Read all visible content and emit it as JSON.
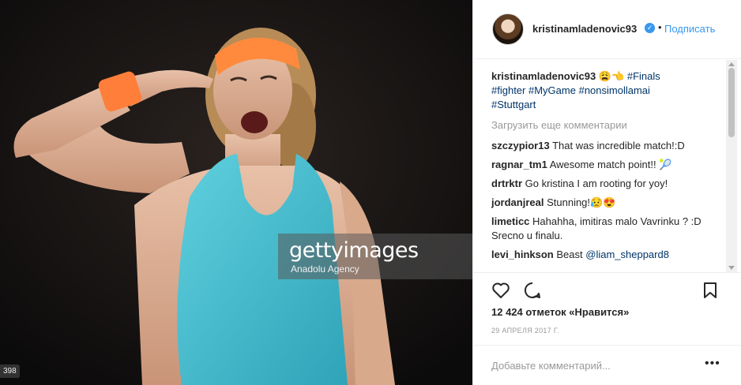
{
  "photo": {
    "watermark_logo": "gettyimages",
    "watermark_agency": "Anadolu Agency",
    "corner_id": "398"
  },
  "post": {
    "username": "kristinamladenovic93",
    "verified_icon": "verified-badge-icon",
    "separator": "•",
    "follow_label": "Подписать",
    "caption": {
      "username": "kristinamladenovic93",
      "emojis": "😩👈",
      "tags": [
        "#Finals",
        "#fighter",
        "#MyGame",
        "#nonsimollamai",
        "#Stuttgart"
      ]
    },
    "load_more": "Загрузить еще комментарии",
    "comments": [
      {
        "user": "szczypior13",
        "text": "That was incredible match!:D"
      },
      {
        "user": "ragnar_tm1",
        "text": "Awesome match point!! 🎾"
      },
      {
        "user": "drtrktr",
        "text": "Go kristina I am rooting for yoy!"
      },
      {
        "user": "jordanjreal",
        "text": "Stunning!😥😍"
      },
      {
        "user": "limeticc",
        "text": "Hahahha, imitiras malo Vavrinku ? :D Srecno u finalu."
      },
      {
        "user": "levi_hinkson",
        "text": "Beast",
        "mention": "@liam_sheppard8"
      }
    ],
    "likes": "12 424 отметок «Нравится»",
    "date": "29 АПРЕЛЯ 2017 Г.",
    "comment_placeholder": "Добавьте комментарий...",
    "more_icon": "more-dots-icon"
  },
  "colors": {
    "accent": "#3897f0",
    "hashtag": "#003569",
    "muted": "#999999",
    "shirt": "#4fc3d4",
    "headband": "#ff8a3d"
  }
}
